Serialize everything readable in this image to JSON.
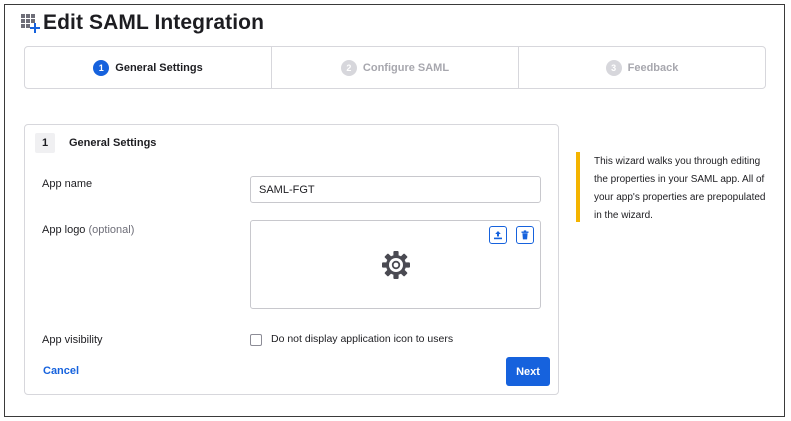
{
  "header": {
    "title": "Edit SAML Integration",
    "icon": "app-grid-add-icon"
  },
  "stepper": {
    "steps": [
      {
        "number": "1",
        "label": "General Settings",
        "state": "active"
      },
      {
        "number": "2",
        "label": "Configure SAML",
        "state": "inactive"
      },
      {
        "number": "3",
        "label": "Feedback",
        "state": "inactive"
      }
    ]
  },
  "form": {
    "section_number": "1",
    "section_title": "General Settings",
    "app_name_label": "App name",
    "app_name_value": "SAML-FGT",
    "app_logo_label": "App logo",
    "app_logo_optional": "(optional)",
    "app_visibility_label": "App visibility",
    "hide_icon_label": "Do not display application icon to users",
    "hide_icon_checked": false,
    "cancel_label": "Cancel",
    "next_label": "Next"
  },
  "help": {
    "text": "This wizard walks you through editing the properties in your SAML app. All of your app's properties are prepopulated in the wizard."
  },
  "colors": {
    "accent": "#1662dd",
    "help_bar": "#f4b400",
    "inactive_step": "#a7a7ae"
  }
}
